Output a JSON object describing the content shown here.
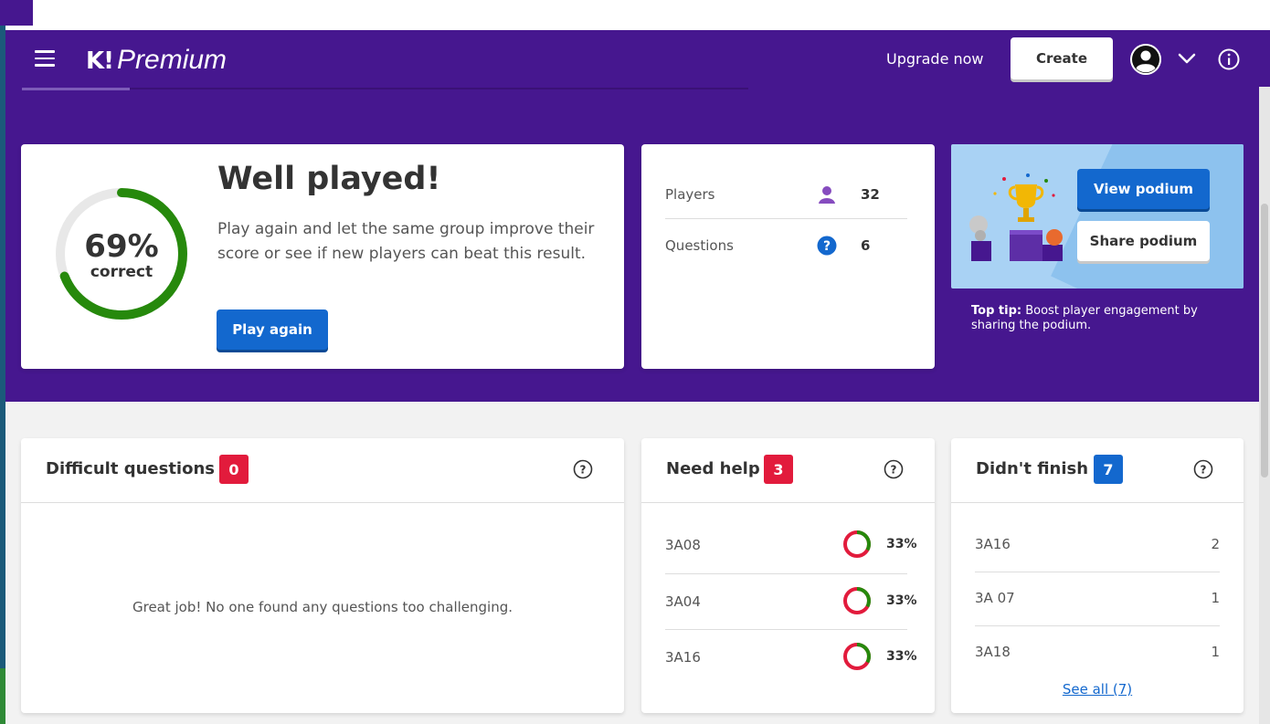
{
  "colors": {
    "brand_purple": "#46178f",
    "primary_blue": "#1368ce",
    "success_green": "#26890c",
    "badge_red": "#e21b3c",
    "wrong_red": "#e21b3c",
    "podium_blue": "#a9d2f4"
  },
  "header": {
    "menu_icon": "hamburger-menu-icon",
    "logo_mark": "K!",
    "logo_word": "Premium",
    "upgrade_label": "Upgrade now",
    "create_label": "Create",
    "avatar_icon": "user-avatar-icon",
    "dropdown_icon": "chevron-down-icon",
    "info_icon": "info-icon"
  },
  "result": {
    "percent_label": "69%",
    "percent_value": 0.69,
    "correct_label": "correct",
    "title": "Well played!",
    "description": "Play again and let the same group improve their score or see if new players can beat this result.",
    "play_again_label": "Play again"
  },
  "stats": [
    {
      "label": "Players",
      "icon": "person-icon",
      "value": "32"
    },
    {
      "label": "Questions",
      "icon": "question-circle-icon",
      "value": "6"
    }
  ],
  "podium": {
    "view_label": "View podium",
    "share_label": "Share podium",
    "tip_bold": "Top tip:",
    "tip_text": " Boost player engagement by sharing the podium."
  },
  "difficult": {
    "title": "Difficult questions",
    "count": "0",
    "empty_text": "Great job! No one found any questions too challenging."
  },
  "need_help": {
    "title": "Need help",
    "count": "3",
    "rows": [
      {
        "name": "3A08",
        "percent": "33%",
        "fraction": 0.33
      },
      {
        "name": "3A04",
        "percent": "33%",
        "fraction": 0.33
      },
      {
        "name": "3A16",
        "percent": "33%",
        "fraction": 0.33
      }
    ]
  },
  "didnt_finish": {
    "title": "Didn't finish",
    "count": "7",
    "rows": [
      {
        "name": "3A16",
        "value": "2"
      },
      {
        "name": "3A 07",
        "value": "1"
      },
      {
        "name": "3A18",
        "value": "1"
      }
    ],
    "see_all_label": "See all (7)"
  }
}
